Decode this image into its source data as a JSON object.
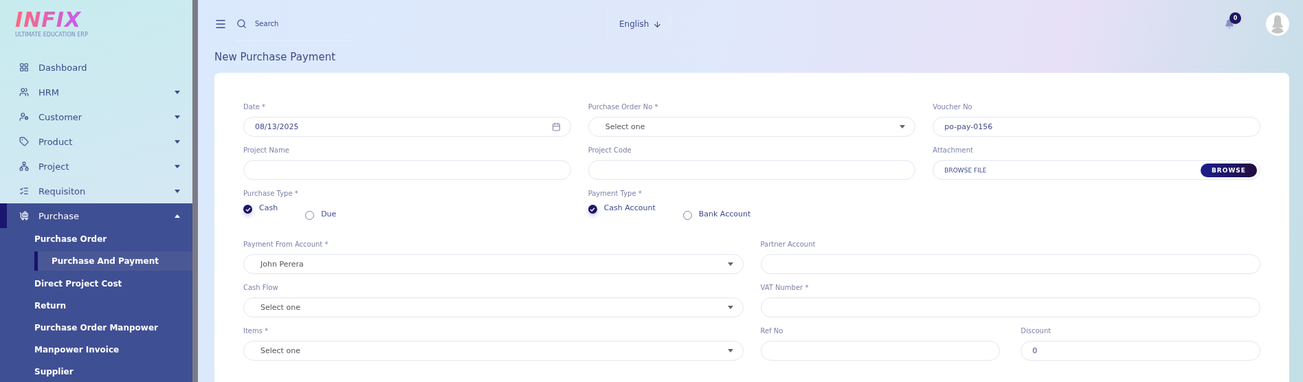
{
  "sidebar": {
    "logo": {
      "title": "INFIX",
      "subtitle": "ULTIMATE EDUCATION ERP"
    },
    "items": [
      {
        "label": "Dashboard",
        "kind": "link",
        "selected": false
      },
      {
        "label": "HRM",
        "kind": "group",
        "expanded": false,
        "selected": false
      },
      {
        "label": "Customer",
        "kind": "group",
        "expanded": false,
        "selected": false
      },
      {
        "label": "Product",
        "kind": "group",
        "expanded": false,
        "selected": false
      },
      {
        "label": "Project",
        "kind": "group",
        "expanded": false,
        "selected": false
      },
      {
        "label": "Requisiton",
        "kind": "group",
        "expanded": false,
        "selected": false
      },
      {
        "label": "Purchase",
        "kind": "group",
        "expanded": true,
        "selected": true,
        "children": [
          {
            "label": "Purchase Order",
            "selected": false
          },
          {
            "label": "Purchase And Payment",
            "selected": true
          },
          {
            "label": "Direct Project Cost",
            "selected": false
          },
          {
            "label": "Return",
            "selected": false
          },
          {
            "label": "Purchase Order Manpower",
            "selected": false
          },
          {
            "label": "Manpower Invoice",
            "selected": false
          },
          {
            "label": "Supplier",
            "selected": false
          }
        ]
      }
    ]
  },
  "topbar": {
    "search": {
      "placeholder": "Search"
    },
    "language": "English",
    "notifications": "0"
  },
  "page_title": "New Purchase Payment",
  "form": {
    "top_fields": [
      {
        "kind": "date",
        "label": "Date *",
        "value": "08/13/2025"
      },
      {
        "kind": "select",
        "label": "Purchase Order No *",
        "value": "Select one"
      },
      {
        "kind": "text",
        "label": "Voucher No",
        "value": "po-pay-0156"
      },
      {
        "kind": "text",
        "label": "Project Name"
      },
      {
        "kind": "text",
        "label": "Project Code"
      },
      {
        "kind": "file",
        "label": "Attachment",
        "value": "BROWSE FILE",
        "button": "BROWSE"
      },
      {
        "kind": "radio",
        "label": "Purchase Type *",
        "options": [
          {
            "label": "Cash",
            "selected": true
          },
          {
            "label": "Due",
            "selected": false
          }
        ]
      },
      {
        "kind": "radio",
        "label": "Payment Type *",
        "options": [
          {
            "label": "Cash Account",
            "selected": true
          },
          {
            "label": "Bank Account",
            "selected": false
          }
        ]
      }
    ],
    "bottom_rows": [
      {
        "left": {
          "kind": "select",
          "label": "Payment From Account *",
          "value": "John Perera"
        },
        "right": [
          {
            "kind": "text",
            "label": "Partner Account"
          }
        ]
      },
      {
        "left": {
          "kind": "select",
          "label": "Cash Flow",
          "value": "Select one"
        },
        "right": [
          {
            "kind": "text",
            "label": "VAT Number *"
          }
        ]
      },
      {
        "left": {
          "kind": "select",
          "label": "Items *",
          "value": "Select one"
        },
        "right": [
          {
            "kind": "text",
            "label": "Ref No"
          },
          {
            "kind": "text",
            "label": "Discount",
            "value": "0"
          }
        ]
      }
    ]
  }
}
